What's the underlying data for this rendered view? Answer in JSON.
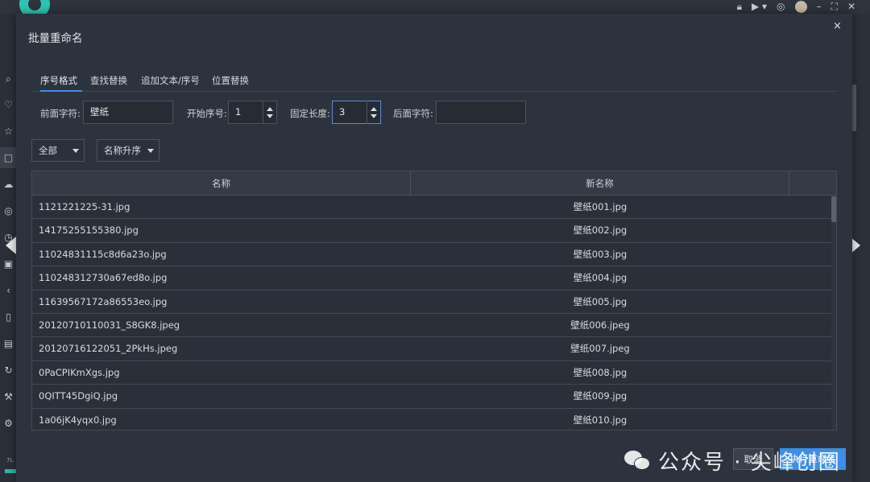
{
  "dialog": {
    "title": "批量重命名",
    "close_glyph": "×"
  },
  "tabs": [
    {
      "label": "序号格式",
      "active": true
    },
    {
      "label": "查找替换",
      "active": false
    },
    {
      "label": "追加文本/序号",
      "active": false
    },
    {
      "label": "位置替换",
      "active": false
    }
  ],
  "form": {
    "prefix_label": "前面字符:",
    "prefix_value": "壁纸",
    "start_label": "开始序号:",
    "start_value": "1",
    "length_label": "固定长度:",
    "length_value": "3",
    "suffix_label": "后面字符:",
    "suffix_value": ""
  },
  "filters": {
    "scope": "全部",
    "sort": "名称升序"
  },
  "table": {
    "headers": [
      "名称",
      "新名称"
    ],
    "rows": [
      {
        "name": "1121221225-31.jpg",
        "new_name": "壁纸001.jpg"
      },
      {
        "name": "14175255155380.jpg",
        "new_name": "壁纸002.jpg"
      },
      {
        "name": "11024831115c8d6a23o.jpg",
        "new_name": "壁纸003.jpg"
      },
      {
        "name": "110248312730a67ed8o.jpg",
        "new_name": "壁纸004.jpg"
      },
      {
        "name": "11639567172a86553eo.jpg",
        "new_name": "壁纸005.jpg"
      },
      {
        "name": "20120710110031_S8GK8.jpeg",
        "new_name": "壁纸006.jpeg"
      },
      {
        "name": "20120716122051_2PkHs.jpeg",
        "new_name": "壁纸007.jpeg"
      },
      {
        "name": "0PaCPIKmXgs.jpg",
        "new_name": "壁纸008.jpg"
      },
      {
        "name": "0QITT45DgiQ.jpg",
        "new_name": "壁纸009.jpg"
      },
      {
        "name": "1a06jK4yqx0.jpg",
        "new_name": "壁纸010.jpg"
      }
    ]
  },
  "buttons": {
    "cancel": "取消",
    "execute": "执行重命名"
  },
  "watermark": {
    "text": "公众号 · 尖峰创圈"
  },
  "sidebar_version": "7L",
  "colors": {
    "accent": "#3d8ee6",
    "dialog_bg": "#2d333e",
    "logo": "#2fc3b2"
  },
  "icons": {
    "sidebar": [
      "search-icon",
      "heart-icon",
      "star-icon",
      "folder-icon",
      "cloud-icon",
      "camera-icon",
      "clock-icon",
      "save-icon",
      "share-icon",
      "trash-icon",
      "file-icon",
      "sync-icon",
      "wrench-icon",
      "gear-icon"
    ],
    "topbar": [
      "lock-icon",
      "play-icon",
      "palette-icon",
      "avatar",
      "minimize-icon",
      "fullscreen-icon",
      "close-icon"
    ]
  }
}
